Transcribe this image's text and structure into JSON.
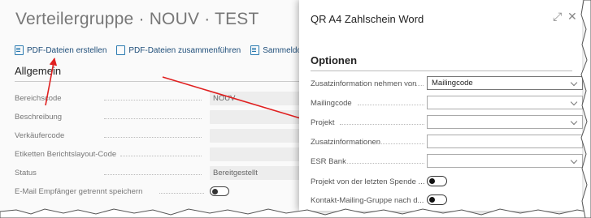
{
  "background_page": {
    "title": "Verteilergruppe · NOUV · TEST",
    "toolbar": [
      {
        "label": "PDF-Dateien erstellen",
        "icon": "pdf-document-icon"
      },
      {
        "label": "PDF-Dateien zusammenführen",
        "icon": "pdf-merge-icon"
      },
      {
        "label": "Sammeldokumente",
        "icon": "collection-document-icon"
      }
    ],
    "section_title": "Allgemein",
    "fields": [
      {
        "label": "Bereichscode",
        "value": "NOUV"
      },
      {
        "label": "Beschreibung",
        "value": ""
      },
      {
        "label": "Verkäufercode",
        "value": ""
      },
      {
        "label": "Etiketten Berichtslayout-Code",
        "value": ""
      },
      {
        "label": "Status",
        "value": "Bereitgestellt"
      },
      {
        "label": "E-Mail Empfänger getrennt speichern",
        "toggle": false
      }
    ]
  },
  "dialog": {
    "title": "QR A4 Zahlschein Word",
    "expand_icon": "expand-icon",
    "close_icon": "close-icon",
    "section_title": "Optionen",
    "fields": [
      {
        "label": "Zusatzinformation nehmen von",
        "value": "Mailingcode",
        "type": "select"
      },
      {
        "label": "Mailingcode",
        "value": "",
        "type": "select"
      },
      {
        "label": "Projekt",
        "value": "",
        "type": "select"
      },
      {
        "label": "Zusatzinformationen",
        "value": "",
        "type": "text"
      },
      {
        "label": "ESR Bank",
        "value": "",
        "type": "select"
      },
      {
        "label": "Projekt von der letzten Spende ...",
        "toggle": false,
        "type": "toggle"
      },
      {
        "label": "Kontakt-Mailing-Gruppe nach d...",
        "toggle": false,
        "type": "toggle"
      }
    ]
  },
  "colors": {
    "arrow": "#e02020",
    "link": "#1f4e79",
    "field_border": "#aaaaaa"
  }
}
